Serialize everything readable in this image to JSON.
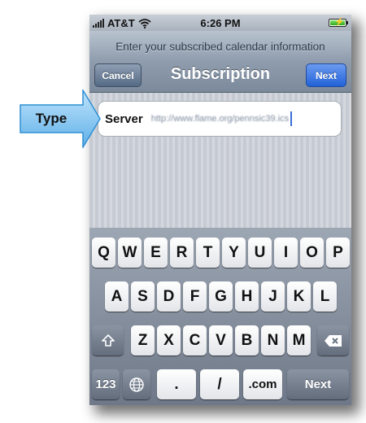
{
  "status_bar": {
    "carrier": "AT&T",
    "time": "6:26 PM"
  },
  "nav": {
    "prompt": "Enter your subscribed calendar information",
    "title": "Subscription",
    "cancel_label": "Cancel",
    "next_label": "Next"
  },
  "field": {
    "label": "Server",
    "value": "http://www.flame.org/pennsic39.ics"
  },
  "callout": {
    "label": "Type"
  },
  "keyboard": {
    "row1": [
      "Q",
      "W",
      "E",
      "R",
      "T",
      "Y",
      "U",
      "I",
      "O",
      "P"
    ],
    "row2": [
      "A",
      "S",
      "D",
      "F",
      "G",
      "H",
      "J",
      "K",
      "L"
    ],
    "row3": [
      "Z",
      "X",
      "C",
      "V",
      "B",
      "N",
      "M"
    ],
    "numbers_label": "123",
    "dot_label": ".",
    "slash_label": "/",
    "dotcom_label": ".com",
    "next_label": "Next"
  },
  "colors": {
    "nav_blue_button": "#2262d8",
    "callout_blue": "#7fc3f0"
  },
  "icons": [
    "wifi-icon",
    "battery-icon",
    "shift-icon",
    "backspace-icon",
    "globe-icon"
  ]
}
